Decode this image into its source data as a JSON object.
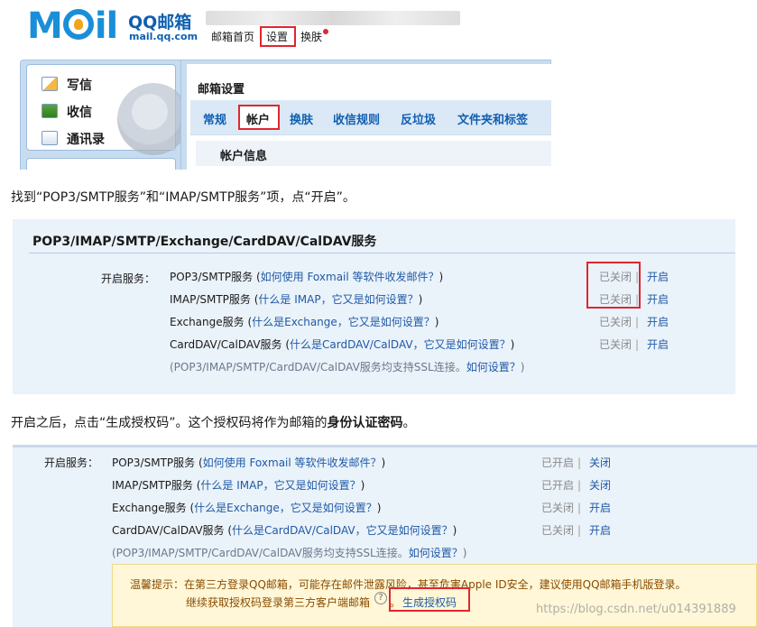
{
  "header": {
    "logo_text": "M",
    "logo_text2": "il",
    "brand_name": "QQ邮箱",
    "brand_url": "mail.qq.com",
    "nav": [
      "邮箱首页",
      "设置",
      "换肤"
    ]
  },
  "sidebar": {
    "items": [
      {
        "label": "写信",
        "icon": "write-icon"
      },
      {
        "label": "收信",
        "icon": "inbox-icon"
      },
      {
        "label": "通讯录",
        "icon": "contacts-icon"
      }
    ]
  },
  "settings": {
    "title": "邮箱设置",
    "tabs": [
      "常规",
      "帐户",
      "换肤",
      "收信规则",
      "反垃圾",
      "文件夹和标签"
    ],
    "active_tab": "帐户",
    "section_title": "帐户信息"
  },
  "instructions": {
    "step1": "找到“POP3/SMTP服务”和“IMAP/SMTP服务”项，点“开启”。",
    "step2_prefix": "开启之后，点击“生成授权码”。这个授权码将作为邮箱的",
    "step2_bold": "身份认证密码",
    "step2_suffix": "。"
  },
  "services_before": {
    "title": "POP3/IMAP/SMTP/Exchange/CardDAV/CalDAV服务",
    "label": "开启服务：",
    "rows": [
      {
        "name": "POP3/SMTP服务",
        "help": "如何使用 Foxmail 等软件收发邮件？",
        "status": "已关闭",
        "action": "开启"
      },
      {
        "name": "IMAP/SMTP服务",
        "help": "什么是 IMAP，它又是如何设置？",
        "status": "已关闭",
        "action": "开启"
      },
      {
        "name": "Exchange服务",
        "help": "什么是Exchange，它又是如何设置？",
        "status": "已关闭",
        "action": "开启"
      },
      {
        "name": "CardDAV/CalDAV服务",
        "help": "什么是CardDAV/CalDAV，它又是如何设置？",
        "status": "已关闭",
        "action": "开启"
      }
    ],
    "note_prefix": "(POP3/IMAP/SMTP/CardDAV/CalDAV服务均支持SSL连接。",
    "note_link": "如何设置？",
    "note_suffix": ")"
  },
  "services_after": {
    "label": "开启服务：",
    "rows": [
      {
        "name": "POP3/SMTP服务",
        "help": "如何使用 Foxmail 等软件收发邮件？",
        "status": "已开启",
        "action": "关闭"
      },
      {
        "name": "IMAP/SMTP服务",
        "help": "什么是 IMAP，它又是如何设置？",
        "status": "已开启",
        "action": "关闭"
      },
      {
        "name": "Exchange服务",
        "help": "什么是Exchange，它又是如何设置？",
        "status": "已关闭",
        "action": "开启"
      },
      {
        "name": "CardDAV/CalDAV服务",
        "help": "什么是CardDAV/CalDAV，它又是如何设置？",
        "status": "已关闭",
        "action": "开启"
      }
    ],
    "note_prefix": "(POP3/IMAP/SMTP/CardDAV/CalDAV服务均支持SSL连接。",
    "note_link": "如何设置？",
    "note_suffix": ")",
    "tip_line1": "温馨提示：在第三方登录QQ邮箱，可能存在邮件泄露风险，甚至危害Apple ID安全，建议使用QQ邮箱手机版登录。",
    "tip_line2": "继续获取授权码登录第三方客户端邮箱",
    "help_mark": "?",
    "tip_period": "。",
    "generate_label": "生成授权码"
  },
  "watermark": "https://blog.csdn.net/u014391889",
  "colors": {
    "accent": "#1f5aa5",
    "highlight_box": "#e0262e",
    "panel_bg": "#eaf2fa",
    "tip_bg": "#fff7d8"
  }
}
